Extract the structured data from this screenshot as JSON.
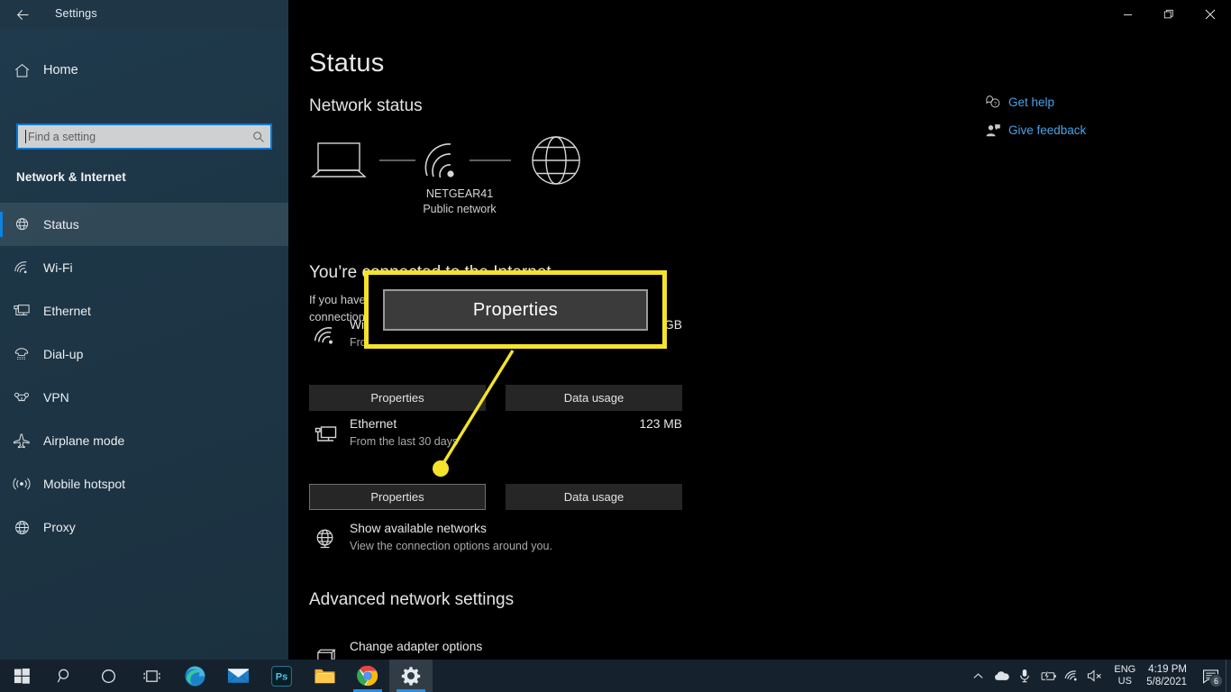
{
  "window": {
    "title": "Settings",
    "back_icon": "back-arrow-icon",
    "minimize_label": "—",
    "maximize_label": "❐",
    "close_label": "✕"
  },
  "sidebar": {
    "home": {
      "label": "Home",
      "icon": "home-icon"
    },
    "search": {
      "placeholder": "Find a setting",
      "icon": "search-icon",
      "value": ""
    },
    "group_title": "Network & Internet",
    "items": [
      {
        "label": "Status",
        "icon": "status-globe-icon",
        "active": true
      },
      {
        "label": "Wi-Fi",
        "icon": "wifi-icon",
        "active": false
      },
      {
        "label": "Ethernet",
        "icon": "ethernet-icon",
        "active": false
      },
      {
        "label": "Dial-up",
        "icon": "dialup-phone-icon",
        "active": false
      },
      {
        "label": "VPN",
        "icon": "vpn-icon",
        "active": false
      },
      {
        "label": "Airplane mode",
        "icon": "airplane-icon",
        "active": false
      },
      {
        "label": "Mobile hotspot",
        "icon": "hotspot-icon",
        "active": false
      },
      {
        "label": "Proxy",
        "icon": "proxy-globe-icon",
        "active": false
      }
    ]
  },
  "main": {
    "page_title": "Status",
    "section_heading": "Network status",
    "help_links": [
      {
        "label": "Get help",
        "icon": "help-question-icon"
      },
      {
        "label": "Give feedback",
        "icon": "feedback-person-icon"
      }
    ],
    "diagram": {
      "device_icon": "laptop-icon",
      "link_icon": "wifi-signal-icon",
      "internet_icon": "globe-icon",
      "network_name": "NETGEAR41",
      "network_type": "Public network"
    },
    "connected_heading": "You’re connected to the Internet",
    "connected_text": "If you have a limited data plan, you can make this network a metered connection or change other properties.",
    "connections": [
      {
        "icon": "wifi-icon",
        "name": "Wi-Fi",
        "sub": "From the last 30 days",
        "value": "5.45 GB",
        "properties_label": "Properties",
        "data_usage_label": "Data usage",
        "properties_focused": false
      },
      {
        "icon": "ethernet-icon",
        "name": "Ethernet",
        "sub": "From the last 30 days",
        "value": "123 MB",
        "properties_label": "Properties",
        "data_usage_label": "Data usage",
        "properties_focused": true
      }
    ],
    "show_networks": {
      "icon": "network-globe-icon",
      "title": "Show available networks",
      "subtitle": "View the connection options around you."
    },
    "advanced_heading": "Advanced network settings",
    "change_adapter": {
      "icon": "adapter-icon",
      "title": "Change adapter options"
    }
  },
  "callout": {
    "button_label": "Properties",
    "highlight_color": "#f5e32a",
    "marker_color": "#f5e32a"
  },
  "taskbar": {
    "items": [
      {
        "name": "start",
        "icon": "windows-logo-icon",
        "running": false,
        "active": false
      },
      {
        "name": "search",
        "icon": "search-icon",
        "running": false,
        "active": false
      },
      {
        "name": "cortana",
        "icon": "cortana-circle-icon",
        "running": false,
        "active": false
      },
      {
        "name": "task-view",
        "icon": "task-view-icon",
        "running": false,
        "active": false
      },
      {
        "name": "edge",
        "icon": "edge-icon",
        "running": false,
        "active": false
      },
      {
        "name": "mail",
        "icon": "mail-icon",
        "running": false,
        "active": false
      },
      {
        "name": "photoshop",
        "icon": "photoshop-icon",
        "running": false,
        "active": false
      },
      {
        "name": "file-explorer",
        "icon": "folder-icon",
        "running": false,
        "active": false
      },
      {
        "name": "chrome",
        "icon": "chrome-icon",
        "running": true,
        "active": false
      },
      {
        "name": "settings",
        "icon": "gear-icon",
        "running": true,
        "active": true
      }
    ],
    "tray": {
      "overflow_icon": "chevron-up-icon",
      "icons": [
        {
          "name": "onedrive-cloud-icon"
        },
        {
          "name": "microphone-icon"
        },
        {
          "name": "battery-charging-icon"
        },
        {
          "name": "wifi-icon"
        },
        {
          "name": "speaker-muted-icon"
        }
      ],
      "language_line1": "ENG",
      "language_line2": "US",
      "time": "4:19 PM",
      "date": "5/8/2021",
      "notification_icon": "notification-icon",
      "notification_count": "6"
    }
  }
}
